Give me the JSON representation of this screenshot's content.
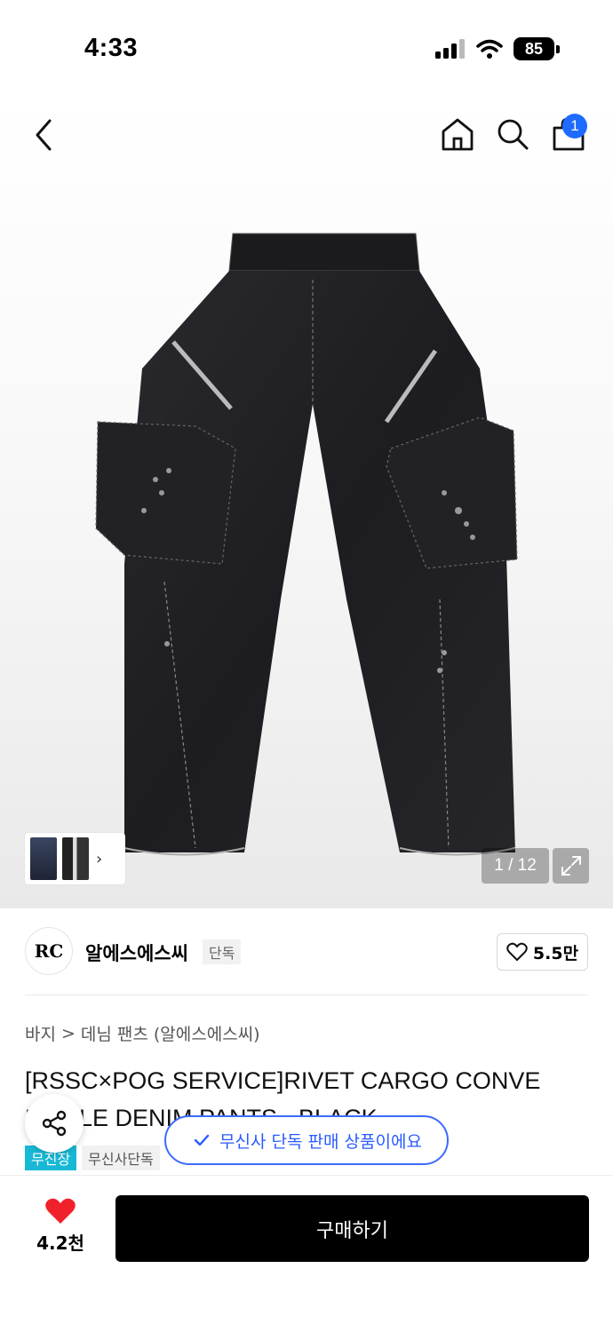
{
  "status_bar": {
    "time": "4:33",
    "battery": "85"
  },
  "header": {
    "cart_count": "1"
  },
  "gallery": {
    "page_indicator": "1 / 12"
  },
  "brand": {
    "name": "알에스에스씨",
    "tag": "단독",
    "likes": "5.5만",
    "logo_text": "RC"
  },
  "breadcrumb": {
    "category": "바지",
    "separator": ">",
    "subcategory": "데님 팬츠 (알에스에스씨)"
  },
  "product": {
    "title_line1": "[RSSC×POG SERVICE]RIVET CARGO CONVE",
    "title_line2": "RTIBLE DENIM PANTS - BLACK",
    "tags": [
      "무진장",
      "무신사단독"
    ]
  },
  "toast": {
    "text": "무신사 단독 판매 상품이에요"
  },
  "bottom": {
    "wish_count": "4.2천",
    "buy_label": "구매하기"
  },
  "colors": {
    "accent": "#1f6bff",
    "tag_cyan": "#18b9d6",
    "buy": "#000000",
    "heart": "#f0212b"
  },
  "icons": [
    "back-icon",
    "home-icon",
    "search-icon",
    "cart-icon",
    "expand-icon",
    "heart-outline-icon",
    "share-icon",
    "check-circle-icon",
    "heart-filled-icon",
    "chevron-right-icon"
  ]
}
